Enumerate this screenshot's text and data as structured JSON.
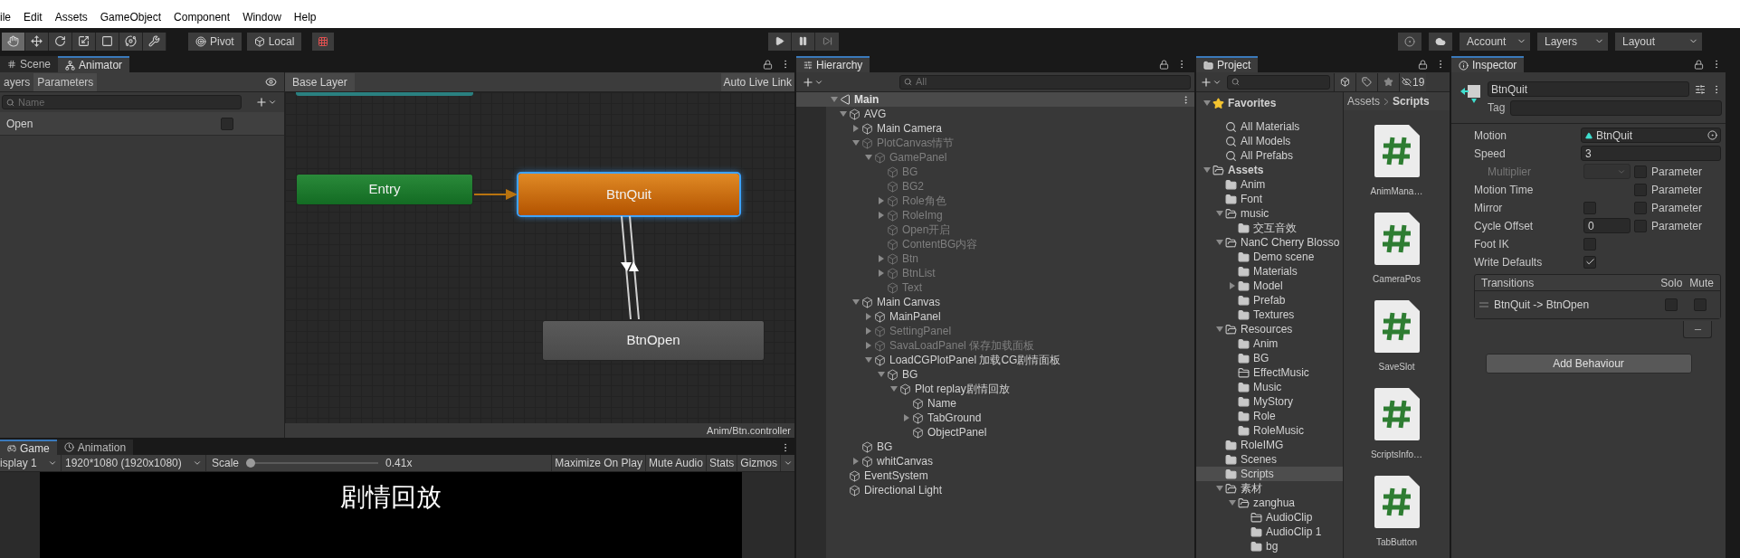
{
  "menu": [
    "ile",
    "Edit",
    "Assets",
    "GameObject",
    "Component",
    "Window",
    "Help"
  ],
  "toolbar": {
    "tools": [
      {
        "selected": true
      },
      {
        "selected": false
      },
      {
        "selected": false
      },
      {
        "selected": false
      },
      {
        "selected": false
      },
      {
        "selected": false
      },
      {
        "selected": false
      }
    ],
    "pivot": "Pivot",
    "local": "Local",
    "account": "Account",
    "layers": "Layers",
    "layout": "Layout"
  },
  "animator": {
    "tabs": [
      {
        "label": "Scene",
        "selected": false
      },
      {
        "label": "Animator",
        "selected": true
      }
    ],
    "left_tabs": [
      {
        "label": "ayers",
        "selected": false
      },
      {
        "label": "Parameters",
        "selected": true
      }
    ],
    "search": {
      "placeholder": "Name"
    },
    "parameters": [
      {
        "name": "Open",
        "value": false
      }
    ],
    "breadcrumb": "Base Layer",
    "live_link": "Auto Live Link",
    "nodes": [
      {
        "label": "Entry",
        "kind": "entry",
        "selected": false
      },
      {
        "label": "BtnQuit",
        "kind": "default",
        "selected": true
      },
      {
        "label": "BtnOpen",
        "kind": "state",
        "selected": false
      }
    ],
    "footer": "Anim/Btn.controller"
  },
  "game": {
    "tabs": [
      {
        "label": "Game",
        "selected": true
      },
      {
        "label": "Animation",
        "selected": false
      }
    ],
    "display": "isplay 1",
    "resolution": "1920*1080 (1920x1080)",
    "scale_label": "Scale",
    "scale": {
      "level": 0
    },
    "scale_reading": "0.41x",
    "buttons": [
      "Maximize On Play",
      "Mute Audio",
      "Stats",
      "Gizmos"
    ],
    "view_text": "剧情回放"
  },
  "hierarchy": {
    "tab": {
      "label": "Hierarchy",
      "selected": true
    },
    "search": {
      "placeholder": "All"
    },
    "scene": {
      "name": "Main",
      "expanded": true
    },
    "items": [
      {
        "name": "AVG",
        "active": true,
        "expanded": true,
        "children": [
          {
            "name": "Main Camera",
            "active": true,
            "expanded": false
          },
          {
            "name": "PlotCanvas情节",
            "active": false,
            "expanded": true,
            "children": [
              {
                "name": "GamePanel",
                "active": false,
                "expanded": true,
                "children": [
                  {
                    "name": "BG",
                    "active": false
                  },
                  {
                    "name": "BG2",
                    "active": false
                  },
                  {
                    "name": "Role角色",
                    "active": false,
                    "expanded": false
                  },
                  {
                    "name": "RoleImg",
                    "active": false,
                    "expanded": false
                  },
                  {
                    "name": "Open开启",
                    "active": false
                  },
                  {
                    "name": "ContentBG内容",
                    "active": false
                  },
                  {
                    "name": "Btn",
                    "active": false,
                    "expanded": false
                  },
                  {
                    "name": "BtnList",
                    "active": false,
                    "expanded": false
                  },
                  {
                    "name": "Text",
                    "active": false
                  }
                ]
              }
            ]
          },
          {
            "name": "Main Canvas",
            "active": true,
            "expanded": true,
            "children": [
              {
                "name": "MainPanel",
                "active": true,
                "expanded": false
              },
              {
                "name": "SettingPanel",
                "active": false,
                "expanded": false
              },
              {
                "name": "SavaLoadPanel 保存加载面板",
                "active": false,
                "expanded": false
              },
              {
                "name": "LoadCGPlotPanel 加载CG剧情面板",
                "active": true,
                "expanded": true,
                "children": [
                  {
                    "name": "BG",
                    "active": true,
                    "expanded": true,
                    "children": [
                      {
                        "name": "Plot replay剧情回放",
                        "active": true,
                        "expanded": true,
                        "children": [
                          {
                            "name": "Name",
                            "active": true
                          },
                          {
                            "name": "TabGround",
                            "active": true,
                            "expanded": false
                          },
                          {
                            "name": "ObjectPanel",
                            "active": true
                          }
                        ]
                      }
                    ]
                  }
                ]
              }
            ]
          },
          {
            "name": "BG",
            "active": true
          },
          {
            "name": "whitCanvas",
            "active": true,
            "expanded": false
          }
        ]
      },
      {
        "name": "EventSystem",
        "active": true
      },
      {
        "name": "Directional Light",
        "active": true
      }
    ]
  },
  "project": {
    "tab": {
      "label": "Project",
      "selected": true
    },
    "hidden_count": "19",
    "tree": [
      {
        "name": "Favorites",
        "kind": "favorites",
        "expanded": true,
        "selected": false,
        "children": [
          {
            "name": "All Materials",
            "kind": "search",
            "selected": false
          },
          {
            "name": "All Models",
            "kind": "search",
            "selected": false
          },
          {
            "name": "All Prefabs",
            "kind": "search",
            "selected": false
          }
        ]
      },
      {
        "name": "Assets",
        "kind": "root",
        "expanded": true,
        "selected": false,
        "children": [
          {
            "name": "Anim",
            "kind": "folder",
            "selected": false
          },
          {
            "name": "Font",
            "kind": "folder",
            "selected": false
          },
          {
            "name": "music",
            "kind": "folder",
            "expanded": true,
            "selected": false,
            "children": [
              {
                "name": "交互音效",
                "kind": "folder",
                "selected": false
              }
            ]
          },
          {
            "name": "NanC Cherry Blosso",
            "kind": "folder",
            "expanded": true,
            "selected": false,
            "children": [
              {
                "name": "Demo scene",
                "kind": "folder",
                "selected": false
              },
              {
                "name": "Materials",
                "kind": "folder",
                "selected": false
              },
              {
                "name": "Model",
                "kind": "folder",
                "expanded": false,
                "selected": false
              },
              {
                "name": "Prefab",
                "kind": "folder",
                "selected": false
              },
              {
                "name": "Textures",
                "kind": "folder",
                "selected": false
              }
            ]
          },
          {
            "name": "Resources",
            "kind": "folder",
            "expanded": true,
            "selected": false,
            "children": [
              {
                "name": "Anim",
                "kind": "folder",
                "selected": false
              },
              {
                "name": "BG",
                "kind": "folder",
                "selected": false
              },
              {
                "name": "EffectMusic",
                "kind": "empty_folder",
                "selected": false
              },
              {
                "name": "Music",
                "kind": "folder",
                "selected": false
              },
              {
                "name": "MyStory",
                "kind": "folder",
                "selected": false
              },
              {
                "name": "Role",
                "kind": "folder",
                "selected": false
              },
              {
                "name": "RoleMusic",
                "kind": "folder",
                "selected": false
              }
            ]
          },
          {
            "name": "RoleIMG",
            "kind": "folder",
            "selected": false
          },
          {
            "name": "Scenes",
            "kind": "folder",
            "selected": false
          },
          {
            "name": "Scripts",
            "kind": "folder",
            "selected": true
          },
          {
            "name": "素材",
            "kind": "folder",
            "expanded": true,
            "selected": false,
            "children": [
              {
                "name": "zanghua",
                "kind": "folder",
                "expanded": true,
                "selected": false,
                "children": [
                  {
                    "name": "AudioClip",
                    "kind": "empty_folder",
                    "selected": false
                  },
                  {
                    "name": "AudioClip 1",
                    "kind": "folder",
                    "selected": false
                  },
                  {
                    "name": "bg",
                    "kind": "folder",
                    "selected": false
                  }
                ]
              }
            ]
          }
        ]
      }
    ],
    "breadcrumb": [
      "Assets",
      "Scripts"
    ],
    "files": [
      "AnimMana…",
      "CameraPos",
      "SaveSlot",
      "ScriptsInfo…",
      "TabButton"
    ]
  },
  "inspector": {
    "tab": {
      "label": "Inspector",
      "selected": true
    },
    "name": "BtnQuit",
    "tag_label": "Tag",
    "properties": [
      {
        "label": "Motion",
        "kind": "object",
        "value": "BtnQuit",
        "disabled": false
      },
      {
        "label": "Speed",
        "kind": "text",
        "value": "3",
        "disabled": false
      },
      {
        "label": "Multiplier",
        "kind": "dropdown",
        "disabled": true,
        "parameter_label": "Parameter",
        "parameter": false
      },
      {
        "label": "Motion Time",
        "kind": "empty",
        "disabled": false,
        "parameter_label": "Parameter",
        "parameter": false
      },
      {
        "label": "Mirror",
        "kind": "checkbox",
        "checked": false,
        "disabled": false,
        "parameter_label": "Parameter",
        "parameter": false
      },
      {
        "label": "Cycle Offset",
        "kind": "short_text",
        "value": "0",
        "disabled": false,
        "parameter_label": "Parameter",
        "parameter": false
      },
      {
        "label": "Foot IK",
        "kind": "checkbox",
        "checked": false,
        "disabled": false
      },
      {
        "label": "Write Defaults",
        "kind": "checkbox",
        "checked": true,
        "disabled": false
      }
    ],
    "transitions": {
      "title": "Transitions",
      "solo_label": "Solo",
      "mute_label": "Mute",
      "rows": [
        {
          "label": "BtnQuit -> BtnOpen",
          "solo": false,
          "mute": false
        }
      ]
    },
    "add_button": "Add Behaviour"
  }
}
